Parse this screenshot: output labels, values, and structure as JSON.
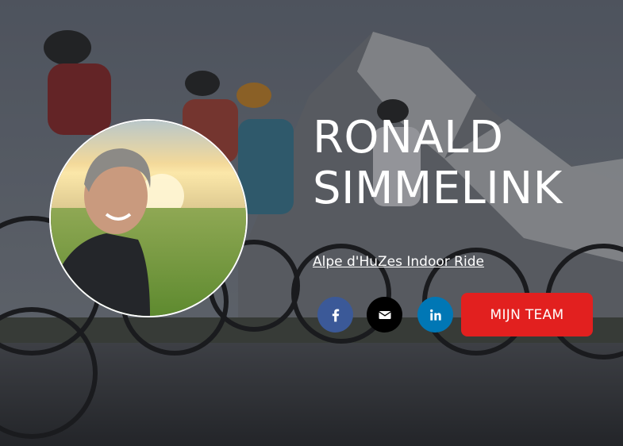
{
  "profile": {
    "first_name": "RONALD",
    "last_name": "SIMMELINK",
    "event_link": "Alpe d'HuZes Indoor Ride"
  },
  "social": [
    {
      "name": "facebook",
      "icon": "facebook-icon",
      "color": "#3b5998"
    },
    {
      "name": "email",
      "icon": "envelope-icon",
      "color": "#000000"
    },
    {
      "name": "linkedin",
      "icon": "linkedin-icon",
      "color": "#0077b5"
    }
  ],
  "team_button": {
    "label": "MIJN TEAM",
    "color": "#e2201f"
  },
  "background": {
    "description_icon": "cyclists-photo"
  }
}
